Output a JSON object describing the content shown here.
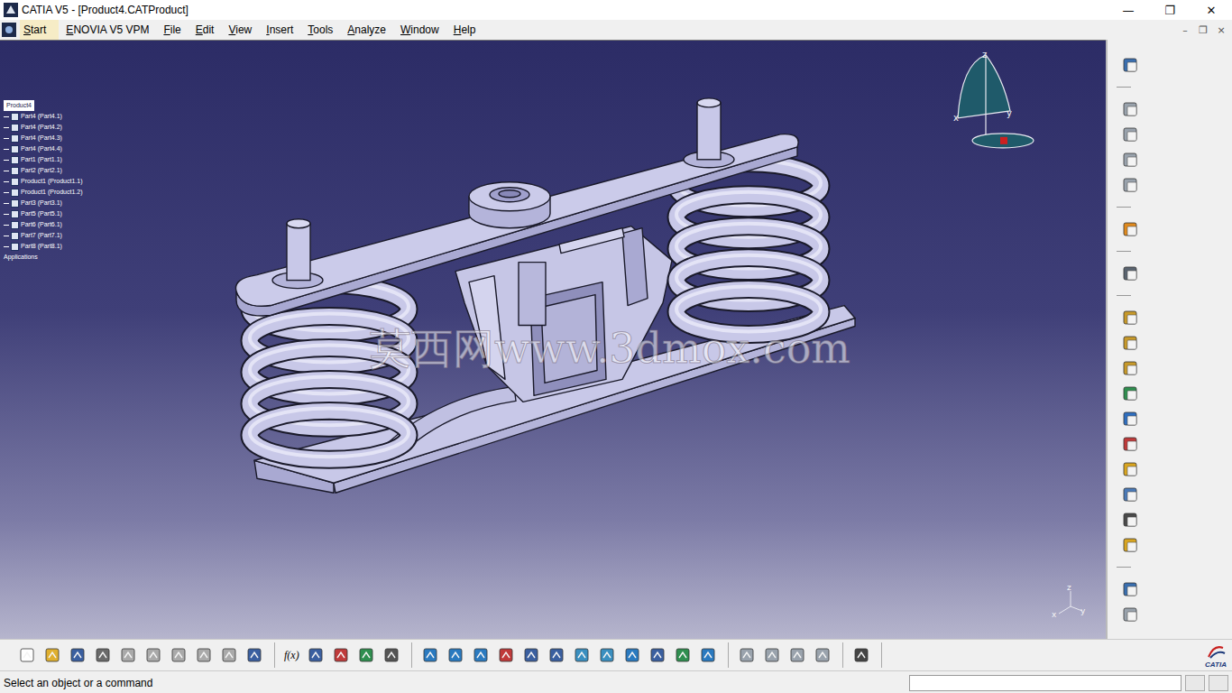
{
  "window": {
    "title": "CATIA V5 - [Product4.CATProduct]",
    "controls": [
      "—",
      "❐",
      "✕"
    ]
  },
  "menu": [
    {
      "label": "Start",
      "selected": true
    },
    {
      "label": "ENOVIA V5 VPM",
      "selected": false
    },
    {
      "label": "File",
      "selected": false
    },
    {
      "label": "Edit",
      "selected": false
    },
    {
      "label": "View",
      "selected": false
    },
    {
      "label": "Insert",
      "selected": false
    },
    {
      "label": "Tools",
      "selected": false
    },
    {
      "label": "Analyze",
      "selected": false
    },
    {
      "label": "Window",
      "selected": false
    },
    {
      "label": "Help",
      "selected": false
    }
  ],
  "mdi_controls": [
    "–",
    "❐",
    "×"
  ],
  "tree": {
    "root": "Product4",
    "items": [
      "Part4 (Part4.1)",
      "Part4 (Part4.2)",
      "Part4 (Part4.3)",
      "Part4 (Part4.4)",
      "Part1 (Part1.1)",
      "Part2 (Part2.1)",
      "Product1 (Product1.1)",
      "Product1 (Product1.2)",
      "Part3 (Part3.1)",
      "Part5 (Part5.1)",
      "Part6 (Part6.1)",
      "Part7 (Part7.1)",
      "Part8 (Part8.1)"
    ],
    "footer": "Applications"
  },
  "viewport": {
    "watermark": "莫西网www.3dmox.com",
    "compass_axes": [
      "z",
      "x",
      "y"
    ],
    "triad_axes": [
      "z",
      "x",
      "y"
    ]
  },
  "toolbar": {
    "formula_label": "f(x)"
  },
  "logo": "CATIA",
  "status_bar": {
    "message": "Select an object or a command",
    "input": ""
  }
}
